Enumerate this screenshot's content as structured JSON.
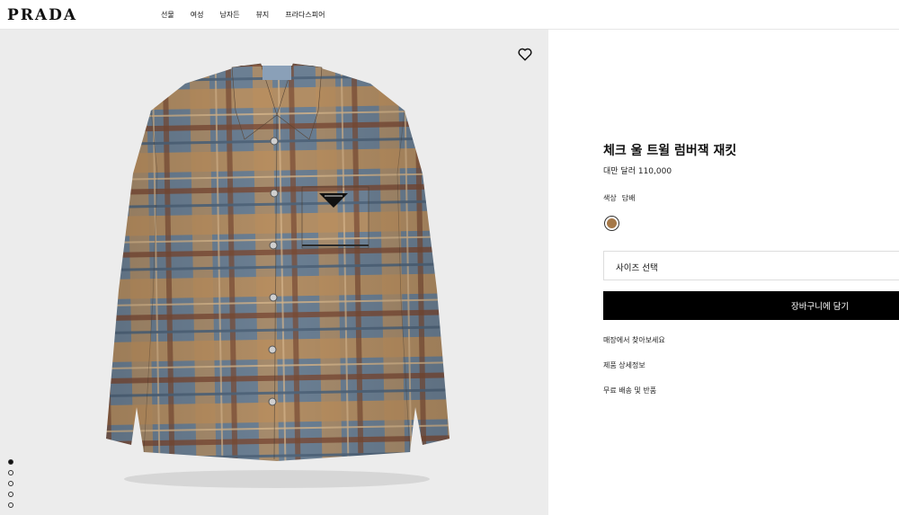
{
  "header": {
    "logo": "PRADA",
    "nav": [
      "선물",
      "여성",
      "남자든",
      "뷰지",
      "프라다스피어"
    ]
  },
  "gallery": {
    "wishlist_icon": "heart-icon",
    "slides": 5,
    "active_slide": 1
  },
  "product": {
    "title": "체크 울 트윌 럼버잭 재킷",
    "price": "대만 달러 110,000",
    "color_label": "색상",
    "color_value": "담배",
    "swatch_color": "#a57848",
    "size_placeholder": "사이즈 선택",
    "cart_label": "장바구니에 담기",
    "links": [
      "매장에서 찾아보세요",
      "제품 상세정보",
      "무료 배송 및 반품"
    ]
  }
}
